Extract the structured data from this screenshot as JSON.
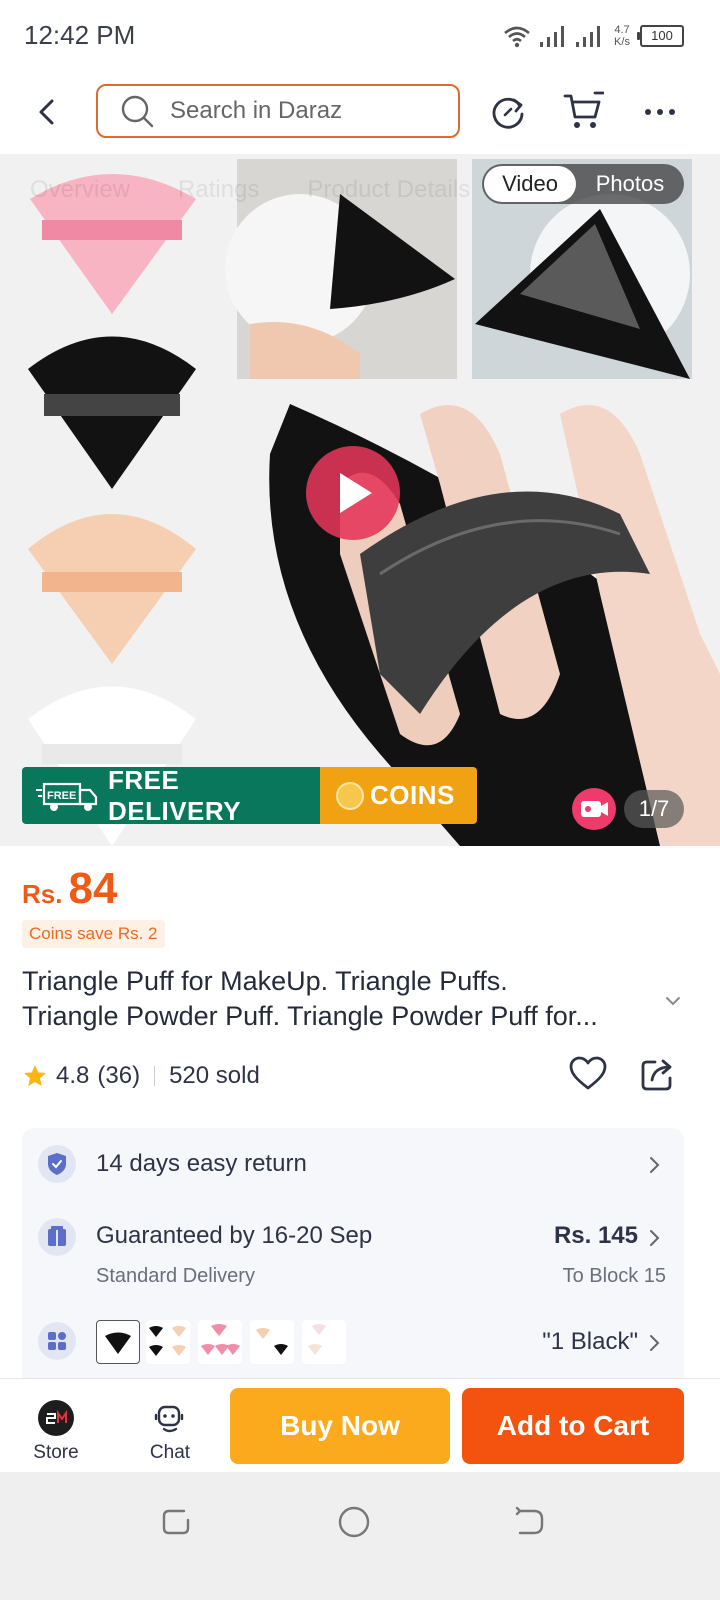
{
  "status_bar": {
    "time": "12:42 PM",
    "network_speed": "4.7",
    "network_unit": "K/s",
    "battery": "100"
  },
  "header": {
    "search_placeholder": "Search in Daraz",
    "icons": [
      "back-arrow-icon",
      "search-icon",
      "refresh-icon",
      "cart-icon",
      "more-icon"
    ]
  },
  "gallery": {
    "faded_tabs": [
      "Overview",
      "Ratings",
      "Product Details"
    ],
    "toggle": {
      "video": "Video",
      "photos": "Photos",
      "active": "video"
    },
    "banner_delivery": "FREE DELIVERY",
    "banner_free_tag": "FREE",
    "banner_coins": "COINS",
    "counter": "1/7"
  },
  "product": {
    "price_currency": "Rs.",
    "price": "84",
    "coins_save": "Coins save Rs. 2",
    "title_line1": "Triangle Puff for MakeUp. Triangle Puffs.",
    "title_line2": "Triangle Powder Puff. Triangle Powder Puff for...",
    "rating": "4.8",
    "rating_count": "(36)",
    "sold": "520 sold"
  },
  "info": {
    "return_text": "14 days easy return",
    "delivery_title": "Guaranteed by 16-20 Sep",
    "delivery_sub": "Standard Delivery",
    "delivery_price": "Rs. 145",
    "delivery_location": "To Block 15",
    "variant_selected": "\"1 Black\""
  },
  "bottom_bar": {
    "store_label": "Store",
    "chat_label": "Chat",
    "buy_now": "Buy Now",
    "add_to_cart": "Add to Cart"
  },
  "colors": {
    "accent_orange": "#f3530f",
    "buy_now_yellow": "#fba91d",
    "delivery_green": "#08775c",
    "coins_gold": "#f0a213",
    "play_pink": "#e43458"
  }
}
